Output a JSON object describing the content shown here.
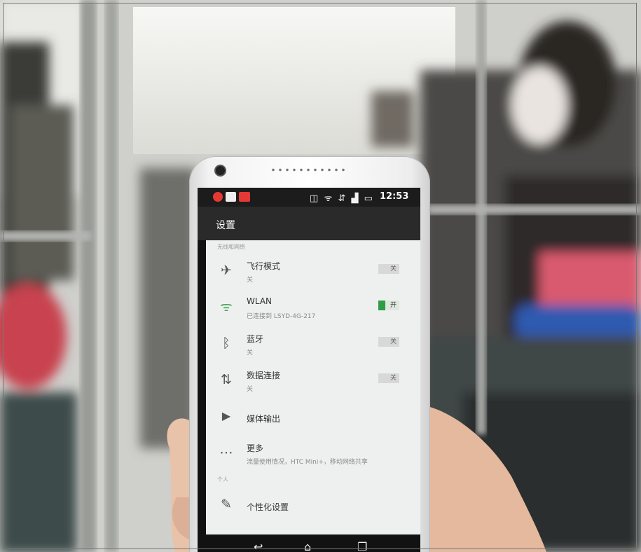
{
  "status_bar": {
    "time": "12:53",
    "icons": [
      "vibrate-icon",
      "wifi-icon",
      "data-icon",
      "signal-icon",
      "battery-icon"
    ]
  },
  "settings": {
    "title": "设置",
    "section_wireless": "无线和网络",
    "section_personal": "个人",
    "items": [
      {
        "icon": "airplane-icon",
        "title": "飞行模式",
        "subtitle": "关",
        "toggle": "关",
        "on": false
      },
      {
        "icon": "wifi-icon",
        "title": "WLAN",
        "subtitle": "已连接到 LSYD-4G-217",
        "toggle": "开",
        "on": true
      },
      {
        "icon": "bluetooth-icon",
        "title": "蓝牙",
        "subtitle": "关",
        "toggle": "关",
        "on": false
      },
      {
        "icon": "data-transfer-icon",
        "title": "数据连接",
        "subtitle": "关",
        "toggle": "关",
        "on": false
      },
      {
        "icon": "media-output-icon",
        "title": "媒体输出",
        "subtitle": "",
        "toggle": "",
        "on": false
      },
      {
        "icon": "more-icon",
        "title": "更多",
        "subtitle": "流量使用情况，HTC Mini+，移动网络共享",
        "toggle": "",
        "on": false
      },
      {
        "icon": "personalize-icon",
        "title": "个性化设置",
        "subtitle": "",
        "toggle": "",
        "on": false
      }
    ]
  },
  "colors": {
    "accent_green": "#2e9d45",
    "notification_red": "#e53935"
  }
}
